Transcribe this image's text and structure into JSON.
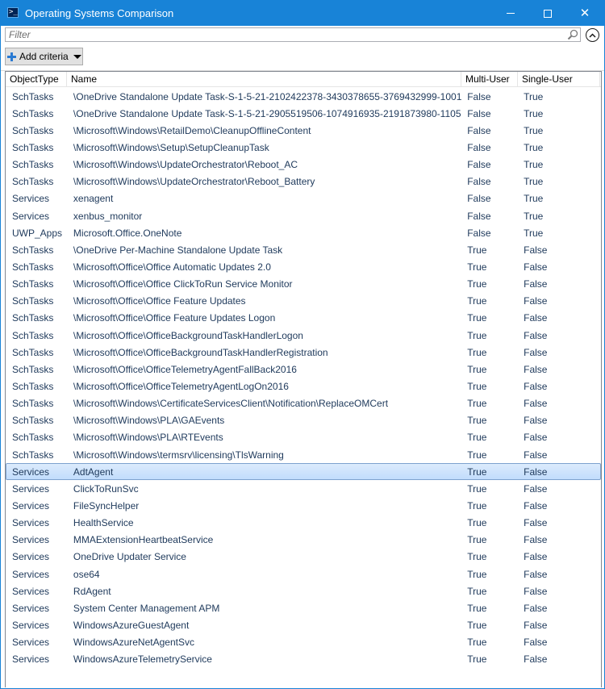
{
  "window": {
    "title": "Operating Systems Comparison",
    "icon": "powershell-icon"
  },
  "filter": {
    "placeholder": "Filter",
    "value": ""
  },
  "toolbar": {
    "add_criteria_label": "Add criteria"
  },
  "columns": [
    "ObjectType",
    "Name",
    "Multi-User",
    "Single-User"
  ],
  "selected_row_index": 22,
  "rows": [
    [
      "SchTasks",
      "\\OneDrive Standalone Update Task-S-1-5-21-2102422378-3430378655-3769432999-1001",
      "False",
      "True"
    ],
    [
      "SchTasks",
      "\\OneDrive Standalone Update Task-S-1-5-21-2905519506-1074916935-2191873980-1105",
      "False",
      "True"
    ],
    [
      "SchTasks",
      "\\Microsoft\\Windows\\RetailDemo\\CleanupOfflineContent",
      "False",
      "True"
    ],
    [
      "SchTasks",
      "\\Microsoft\\Windows\\Setup\\SetupCleanupTask",
      "False",
      "True"
    ],
    [
      "SchTasks",
      "\\Microsoft\\Windows\\UpdateOrchestrator\\Reboot_AC",
      "False",
      "True"
    ],
    [
      "SchTasks",
      "\\Microsoft\\Windows\\UpdateOrchestrator\\Reboot_Battery",
      "False",
      "True"
    ],
    [
      "Services",
      "xenagent",
      "False",
      "True"
    ],
    [
      "Services",
      "xenbus_monitor",
      "False",
      "True"
    ],
    [
      "UWP_Apps",
      "Microsoft.Office.OneNote",
      "False",
      "True"
    ],
    [
      "SchTasks",
      "\\OneDrive Per-Machine Standalone Update Task",
      "True",
      "False"
    ],
    [
      "SchTasks",
      "\\Microsoft\\Office\\Office Automatic Updates 2.0",
      "True",
      "False"
    ],
    [
      "SchTasks",
      "\\Microsoft\\Office\\Office ClickToRun Service Monitor",
      "True",
      "False"
    ],
    [
      "SchTasks",
      "\\Microsoft\\Office\\Office Feature Updates",
      "True",
      "False"
    ],
    [
      "SchTasks",
      "\\Microsoft\\Office\\Office Feature Updates Logon",
      "True",
      "False"
    ],
    [
      "SchTasks",
      "\\Microsoft\\Office\\OfficeBackgroundTaskHandlerLogon",
      "True",
      "False"
    ],
    [
      "SchTasks",
      "\\Microsoft\\Office\\OfficeBackgroundTaskHandlerRegistration",
      "True",
      "False"
    ],
    [
      "SchTasks",
      "\\Microsoft\\Office\\OfficeTelemetryAgentFallBack2016",
      "True",
      "False"
    ],
    [
      "SchTasks",
      "\\Microsoft\\Office\\OfficeTelemetryAgentLogOn2016",
      "True",
      "False"
    ],
    [
      "SchTasks",
      "\\Microsoft\\Windows\\CertificateServicesClient\\Notification\\ReplaceOMCert",
      "True",
      "False"
    ],
    [
      "SchTasks",
      "\\Microsoft\\Windows\\PLA\\GAEvents",
      "True",
      "False"
    ],
    [
      "SchTasks",
      "\\Microsoft\\Windows\\PLA\\RTEvents",
      "True",
      "False"
    ],
    [
      "SchTasks",
      "\\Microsoft\\Windows\\termsrv\\licensing\\TlsWarning",
      "True",
      "False"
    ],
    [
      "Services",
      "AdtAgent",
      "True",
      "False"
    ],
    [
      "Services",
      "ClickToRunSvc",
      "True",
      "False"
    ],
    [
      "Services",
      "FileSyncHelper",
      "True",
      "False"
    ],
    [
      "Services",
      "HealthService",
      "True",
      "False"
    ],
    [
      "Services",
      "MMAExtensionHeartbeatService",
      "True",
      "False"
    ],
    [
      "Services",
      "OneDrive Updater Service",
      "True",
      "False"
    ],
    [
      "Services",
      "ose64",
      "True",
      "False"
    ],
    [
      "Services",
      "RdAgent",
      "True",
      "False"
    ],
    [
      "Services",
      "System Center Management APM",
      "True",
      "False"
    ],
    [
      "Services",
      "WindowsAzureGuestAgent",
      "True",
      "False"
    ],
    [
      "Services",
      "WindowsAzureNetAgentSvc",
      "True",
      "False"
    ],
    [
      "Services",
      "WindowsAzureTelemetryService",
      "True",
      "False"
    ]
  ]
}
